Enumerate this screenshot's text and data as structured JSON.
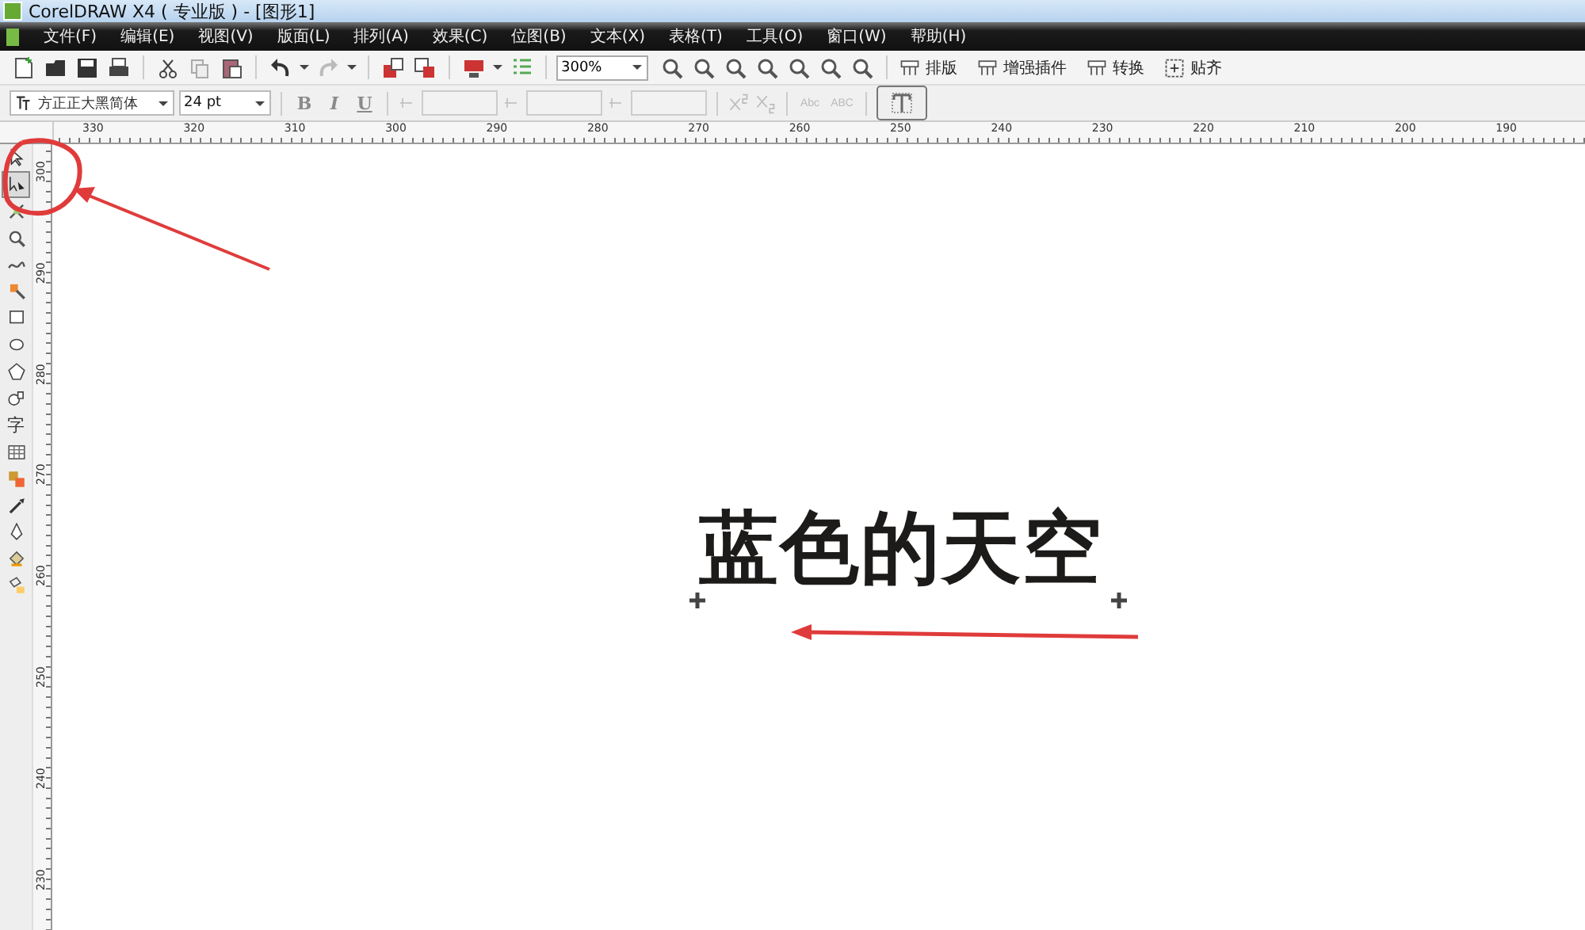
{
  "window": {
    "title": "CorelDRAW X4 ( 专业版 ) - [图形1]"
  },
  "menu": [
    "文件(F)",
    "编辑(E)",
    "视图(V)",
    "版面(L)",
    "排列(A)",
    "效果(C)",
    "位图(B)",
    "文本(X)",
    "表格(T)",
    "工具(O)",
    "窗口(W)",
    "帮助(H)"
  ],
  "standard_toolbar": {
    "zoom_level": "300%",
    "plugin_buttons": [
      "排版",
      "增强插件",
      "转换",
      "贴齐"
    ]
  },
  "property_bar": {
    "font_name": "方正正大黑简体",
    "font_size": "24 pt",
    "style_buttons": [
      {
        "label": "B",
        "disabled": true
      },
      {
        "label": "I",
        "disabled": true
      },
      {
        "label": "U",
        "disabled": true
      }
    ],
    "spin_fields": [
      {
        "disabled": true
      },
      {
        "disabled": true
      },
      {
        "disabled": true
      }
    ],
    "case_buttons": [
      {
        "label": "Abc",
        "disabled": true
      },
      {
        "label": "ABC",
        "disabled": true
      }
    ]
  },
  "rulers": {
    "horizontal": [
      "330",
      "320",
      "310",
      "300",
      "290",
      "280",
      "270",
      "260",
      "250",
      "240",
      "230",
      "220",
      "210",
      "200",
      "190"
    ],
    "vertical": [
      "300",
      "290",
      "280",
      "270",
      "260",
      "250",
      "240",
      "230"
    ]
  },
  "toolbox": {
    "tools": [
      {
        "kind": "pick",
        "selected": false
      },
      {
        "kind": "shape",
        "selected": true
      },
      {
        "kind": "crop",
        "selected": false
      },
      {
        "kind": "zoom",
        "selected": false
      },
      {
        "kind": "freehand",
        "selected": false
      },
      {
        "kind": "smartfill",
        "selected": false
      },
      {
        "kind": "rectangle",
        "selected": false
      },
      {
        "kind": "ellipse",
        "selected": false
      },
      {
        "kind": "polygon",
        "selected": false
      },
      {
        "kind": "basic-shapes",
        "selected": false
      },
      {
        "kind": "text",
        "label": "字",
        "selected": false
      },
      {
        "kind": "table",
        "selected": false
      },
      {
        "kind": "blend",
        "selected": false
      },
      {
        "kind": "eyedropper",
        "selected": false
      },
      {
        "kind": "outline",
        "selected": false
      },
      {
        "kind": "fill",
        "selected": false
      },
      {
        "kind": "interactive-fill",
        "selected": false
      }
    ]
  },
  "canvas": {
    "text": "蓝色的天空"
  }
}
